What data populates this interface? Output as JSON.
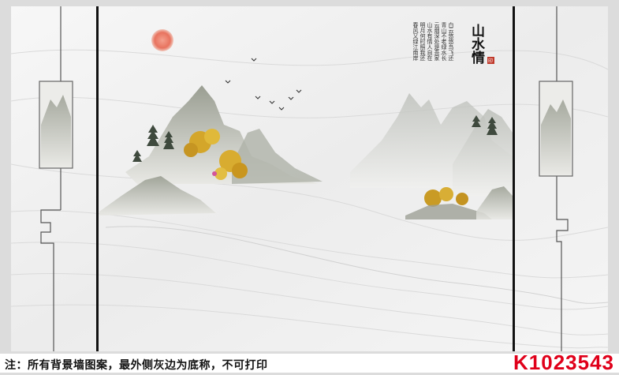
{
  "image": {
    "title_calligraphy": "山水情",
    "seal": "印",
    "poem_lines": [
      "春风又绿江南岸",
      "明月何时照我还",
      "山水有情人自在",
      "云烟深处是吾家",
      "青山不老绿水长",
      "白云悠悠鸟飞还"
    ]
  },
  "footer": {
    "note": "注：所有背景墙图案，最外侧灰边为底称，不可打印",
    "code": "K1023543"
  },
  "colors": {
    "sun": "#e8735f",
    "frame_line": "#111111",
    "code": "#e0001a",
    "foliage": "#d4a62a"
  }
}
